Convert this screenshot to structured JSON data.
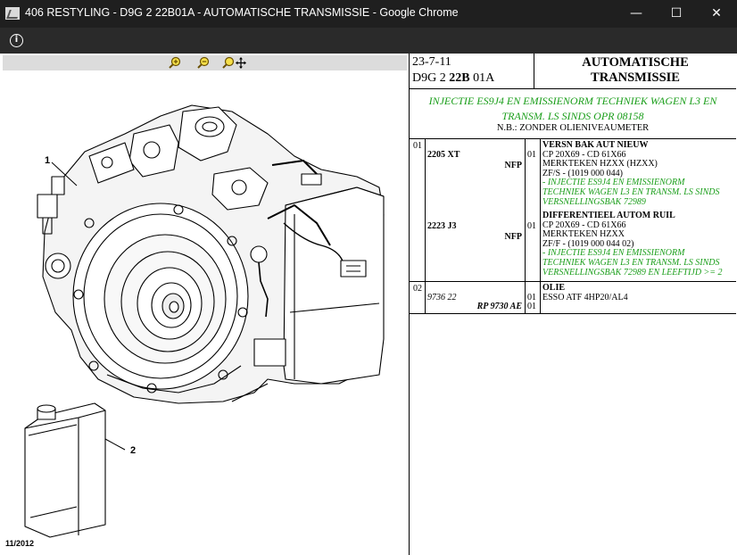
{
  "window": {
    "title": "406 RESTYLING - D9G 2 22B01A - AUTOMATISCHE TRANSMISSIE - Google Chrome",
    "minimize_glyph": "—",
    "maximize_glyph": "☐",
    "close_glyph": "✕"
  },
  "toolbar": {
    "info_glyph": "i"
  },
  "diagram": {
    "callouts": [
      "1",
      "2"
    ],
    "date": "11/2012",
    "zoom_icons": [
      "zoom-in-icon",
      "zoom-out-icon",
      "zoom-pan-icon"
    ]
  },
  "header": {
    "date": "23-7-11",
    "code_prefix": "D9G 2",
    "code_bold": "22B",
    "code_suffix": "01A",
    "title_line1": "AUTOMATISCHE",
    "title_line2": "TRANSMISSIE"
  },
  "subheader": {
    "green_line1": "INJECTIE ES9J4 EN EMISSIENORM TECHNIEK WAGEN L3 EN",
    "green_line2": "TRANSM. LS SINDS OPR 08158",
    "note": "N.B.: ZONDER OLIENIVEAUMETER"
  },
  "sections": [
    {
      "number": "01",
      "items": [
        {
          "ref": "2205 XT",
          "nfp": "NFP",
          "qty": "01",
          "title": "VERSN BAK AUT NIEUW",
          "lines": [
            "CP 20X69 - CD 61X66",
            "MERKTEKEN HZXX (HZXX)",
            "ZF/S - (1019 000 044)"
          ],
          "green": [
            "- INJECTIE ES9J4 EN EMISSIENORM",
            "TECHNIEK WAGEN L3 EN TRANSM. LS SINDS",
            "VERSNELLINGSBAK 72989"
          ]
        },
        {
          "ref": "2223 J3",
          "nfp": "NFP",
          "qty": "01",
          "title": "DIFFERENTIEEL AUTOM RUIL",
          "lines": [
            "CP 20X69 - CD 61X66",
            "MERKTEKEN HZXX",
            "ZF/F - (1019 000 044 02)"
          ],
          "green": [
            "- INJECTIE ES9J4 EN EMISSIENORM",
            "TECHNIEK WAGEN L3 EN TRANSM. LS SINDS",
            "VERSNELLINGSBAK 72989 EN LEEFTIJD >= 2"
          ]
        }
      ]
    },
    {
      "number": "02",
      "items": [
        {
          "ref": "9736 22",
          "nfp": "RP 9730 AE",
          "qty": "01",
          "qty2": "01",
          "title": "OLIE",
          "lines": [
            "ESSO ATF 4HP20/AL4"
          ]
        }
      ]
    }
  ],
  "colors": {
    "green_text": "#1a9e1a",
    "titlebar": "#1f1f1f",
    "toolbar": "#2a2a2a"
  }
}
